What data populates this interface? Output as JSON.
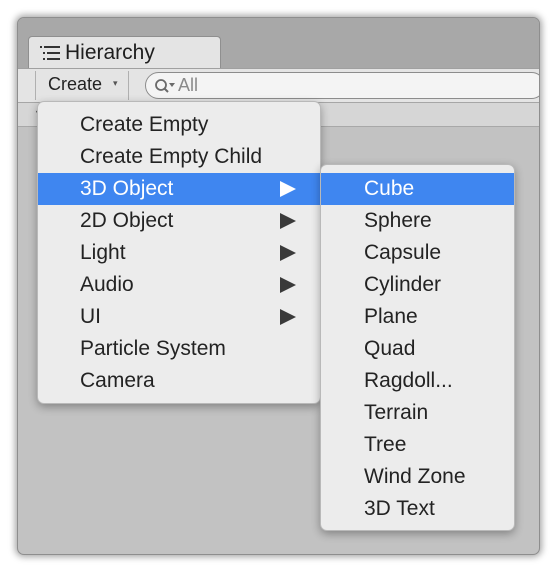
{
  "panel": {
    "tab_title": "Hierarchy",
    "tab_icon": "list-icon"
  },
  "toolbar": {
    "create_label": "Create",
    "create_arrow": "▾",
    "search_icon": "search-icon",
    "search_placeholder": "All",
    "search_value": ""
  },
  "menu": {
    "items": [
      {
        "label": "Create Empty",
        "submenu": false
      },
      {
        "label": "Create Empty Child",
        "submenu": false
      },
      {
        "label": "3D Object",
        "submenu": true,
        "selected": true
      },
      {
        "label": "2D Object",
        "submenu": true
      },
      {
        "label": "Light",
        "submenu": true
      },
      {
        "label": "Audio",
        "submenu": true
      },
      {
        "label": "UI",
        "submenu": true
      },
      {
        "label": "Particle System",
        "submenu": false
      },
      {
        "label": "Camera",
        "submenu": false
      }
    ]
  },
  "submenu": {
    "items": [
      {
        "label": "Cube",
        "selected": true
      },
      {
        "label": "Sphere"
      },
      {
        "label": "Capsule"
      },
      {
        "label": "Cylinder"
      },
      {
        "label": "Plane"
      },
      {
        "label": "Quad"
      },
      {
        "label": "Ragdoll..."
      },
      {
        "label": "Terrain"
      },
      {
        "label": "Tree"
      },
      {
        "label": "Wind Zone"
      },
      {
        "label": "3D Text"
      }
    ]
  },
  "colors": {
    "highlight": "#3f86f0",
    "menu_bg": "#ececec",
    "panel_bg": "#c2c2c2"
  }
}
